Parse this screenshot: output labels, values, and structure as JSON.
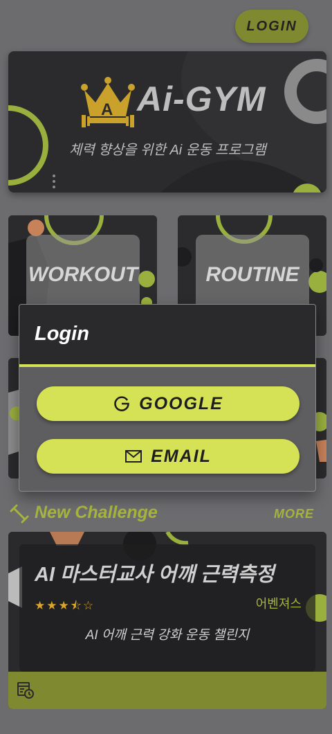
{
  "header": {
    "login_label": "LOGIN"
  },
  "banner": {
    "title": "Ai-GYM",
    "subtitle": "체력 향상을 위한 Ai 운동 프로그램",
    "logo_letter": "A"
  },
  "cards": [
    {
      "label": "WORKOUT"
    },
    {
      "label": "ROUTINE"
    }
  ],
  "challenge": {
    "section_title": "New Challenge",
    "more_label": "MORE",
    "title": "AI 마스터교사 어깨 근력측정",
    "rating": 3.5,
    "stars": "★★★⯪☆",
    "author": "어벤져스",
    "description": "AI 어깨 근력 강화 운동 챌린지"
  },
  "modal": {
    "title": "Login",
    "google_label": "GOOGLE",
    "email_label": "EMAIL"
  },
  "colors": {
    "background": "#6c6c6f",
    "accent": "#d6e256",
    "accent_dark": "#7f8a30",
    "card": "#2a2a2c"
  }
}
